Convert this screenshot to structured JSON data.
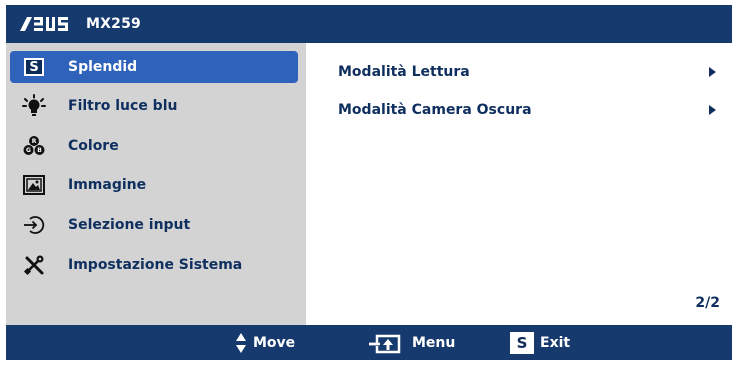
{
  "header": {
    "brand": "ASUS",
    "model": "MX259"
  },
  "menu": {
    "items": [
      {
        "label": "Splendid",
        "icon": "splendid-s-icon",
        "selected": true
      },
      {
        "label": "Filtro luce blu",
        "icon": "bulb-icon",
        "selected": false
      },
      {
        "label": "Colore",
        "icon": "rgb-icon",
        "selected": false
      },
      {
        "label": "Immagine",
        "icon": "image-icon",
        "selected": false
      },
      {
        "label": "Selezione input",
        "icon": "input-icon",
        "selected": false
      },
      {
        "label": "Impostazione Sistema",
        "icon": "tools-icon",
        "selected": false
      }
    ],
    "splendid_badge": "S"
  },
  "submenu": {
    "items": [
      {
        "label": "Modalità Lettura"
      },
      {
        "label": "Modalità Camera Oscura"
      }
    ],
    "page": "2/2"
  },
  "footer": {
    "move_label": "Move",
    "menu_label": "Menu",
    "exit_label": "Exit",
    "exit_badge": "S"
  },
  "colors": {
    "header_bg": "#173a6e",
    "sidebar_bg": "#d3d3d3",
    "selected_bg": "#2f63bb",
    "text": "#0f2f5f"
  }
}
